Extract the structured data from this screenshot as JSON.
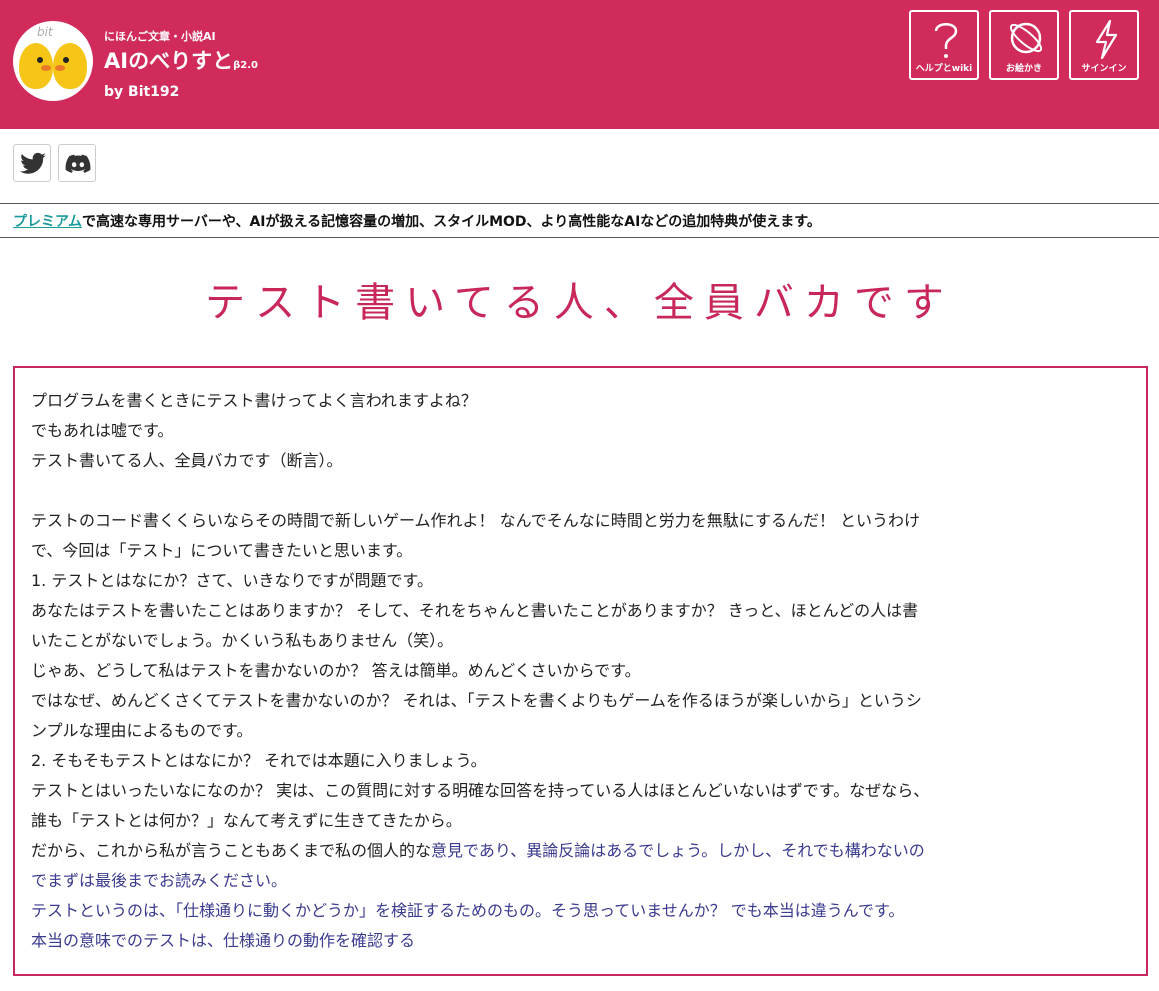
{
  "header": {
    "tagline": "にほんご文章・小説AI",
    "title": "AIのべりすと",
    "version": "β2.0",
    "by": "by Bit192",
    "logo_text": "bit",
    "buttons": [
      {
        "label": "ヘルプとwiki",
        "icon": "question-icon"
      },
      {
        "label": "お絵かき",
        "icon": "planet-icon"
      },
      {
        "label": "サインイン",
        "icon": "lightning-icon"
      }
    ],
    "colors": {
      "brand": "#d12b5c"
    }
  },
  "social": [
    {
      "icon": "twitter-icon"
    },
    {
      "icon": "discord-icon"
    }
  ],
  "promo": {
    "link": "プレミアム",
    "text": "で高速な専用サーバーや、AIが扱える記憶容量の増加、スタイルMOD、より高性能なAIなどの追加特典が使えます。"
  },
  "story": {
    "title": "テスト書いてる人、全員バカです",
    "lines": [
      "プログラムを書くときにテスト書けってよく言われますよね？",
      "でもあれは嘘です。",
      "テスト書いてる人、全員バカです（断言）。",
      "",
      "テストのコード書くくらいならその時間で新しいゲーム作れよ！ なんでそんなに時間と労力を無駄にするんだ！ というわけ",
      "で、今回は「テスト」について書きたいと思います。",
      "1. テストとはなにか？さて、いきなりですが問題です。",
      "あなたはテストを書いたことはありますか？ そして、それをちゃんと書いたことがありますか？ きっと、ほとんどの人は書",
      "いたことがないでしょう。かくいう私もありません（笑）。",
      "じゃあ、どうして私はテストを書かないのか？ 答えは簡単。めんどくさいからです。",
      "ではなぜ、めんどくさくてテストを書かないのか？ それは、「テストを書くよりもゲームを作るほうが楽しいから」というシ",
      "ンプルな理由によるものです。",
      "2. そもそもテストとはなにか？ それでは本題に入りましょう。",
      "テストとはいったいなになのか？ 実は、この質問に対する明確な回答を持っている人はほとんどいないはずです。なぜなら、",
      "誰も「テストとは何か？」なんて考えずに生きてきたから。"
    ],
    "mixed_line": {
      "plain": "だから、これから私が言うこともあくまで私の個人的な",
      "ai": "意見であり、異論反論はあるでしょう。しかし、それでも構わないの"
    },
    "ai_lines": [
      "でまずは最後までお読みください。",
      "テストというのは、「仕様通りに動くかどうか」を検証するためのもの。そう思っていませんか？ でも本当は違うんです。",
      "本当の意味でのテストは、仕様通りの動作を確認する"
    ]
  }
}
